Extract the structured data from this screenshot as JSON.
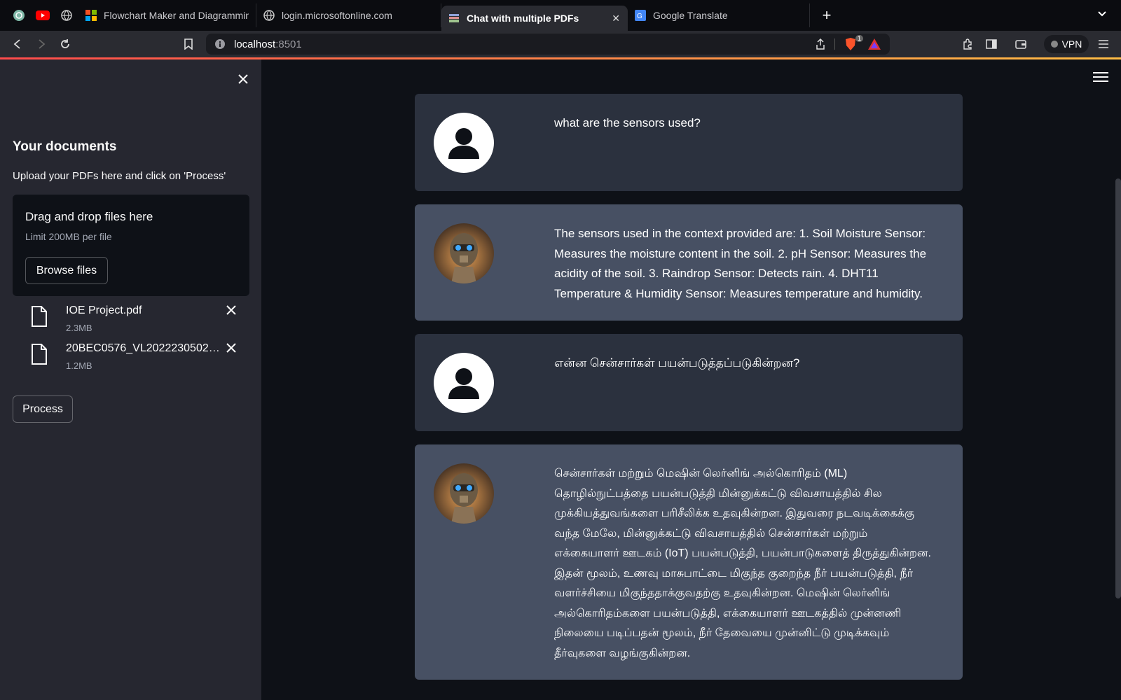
{
  "browser": {
    "tabs": [
      {
        "title": "Flowchart Maker and Diagramming",
        "active": false
      },
      {
        "title": "login.microsoftonline.com",
        "active": false
      },
      {
        "title": "Chat with multiple PDFs",
        "active": true
      },
      {
        "title": "Google Translate",
        "active": false
      }
    ],
    "url_host": "localhost",
    "url_port": ":8501",
    "brave_badge": "1",
    "vpn_label": "VPN"
  },
  "sidebar": {
    "title": "Your documents",
    "subtitle": "Upload your PDFs here and click on 'Process'",
    "dropzone": {
      "title": "Drag and drop files here",
      "limit": "Limit 200MB per file",
      "browse_label": "Browse files"
    },
    "files": [
      {
        "name": "IOE Project.pdf",
        "size": "2.3MB"
      },
      {
        "name": "20BEC0576_VL2022230502…",
        "size": "1.2MB"
      }
    ],
    "process_label": "Process"
  },
  "chat": {
    "messages": [
      {
        "role": "user",
        "text": "what are the sensors used?"
      },
      {
        "role": "bot",
        "text": "The sensors used in the context provided are: 1. Soil Moisture Sensor: Measures the moisture content in the soil. 2. pH Sensor: Measures the acidity of the soil. 3. Raindrop Sensor: Detects rain. 4. DHT11 Temperature & Humidity Sensor: Measures temperature and humidity."
      },
      {
        "role": "user",
        "text": "என்ன சென்சார்கள் பயன்படுத்தப்படுகின்றன?"
      },
      {
        "role": "bot",
        "text": "சென்சார்கள் மற்றும் மெஷின் லெர்னிங் அல்கொரிதம் (ML) தொழில்நுட்பத்தை பயன்படுத்தி மின்னுக்கட்டு விவசாயத்தில் சில முக்கியத்துவங்களை பரிசீலிக்க உதவுகின்றன. இதுவரை நடவடிக்கைக்கு வந்த மேலே, மின்னுக்கட்டு விவசாயத்தில் சென்சார்கள் மற்றும் எக்கையாளர் ஊடகம் (IoT) பயன்படுத்தி, பயன்பாடுகளைத் திருத்துகின்றன. இதன் மூலம், உணவு மாசுபாட்டை மிகுந்த குறைந்த நீர் பயன்படுத்தி, நீர் வளர்ச்சியை மிகுந்ததாக்குவதற்கு உதவுகின்றன. மெஷின் லெர்னிங் அல்கொரிதம்களை பயன்படுத்தி, எக்கையாளர் ஊடகத்தில் முன்னணி நிலையை படிப்பதன் மூலம், நீர் தேவையை முன்னிட்டு முடிக்கவும் தீர்வுகளை வழங்குகின்றன."
      }
    ]
  },
  "colors": {
    "sidebar_bg": "#262730",
    "main_bg": "#0e1117",
    "user_msg_bg": "#2b313e",
    "bot_msg_bg": "#475063",
    "accent": "#ff4b4b"
  }
}
